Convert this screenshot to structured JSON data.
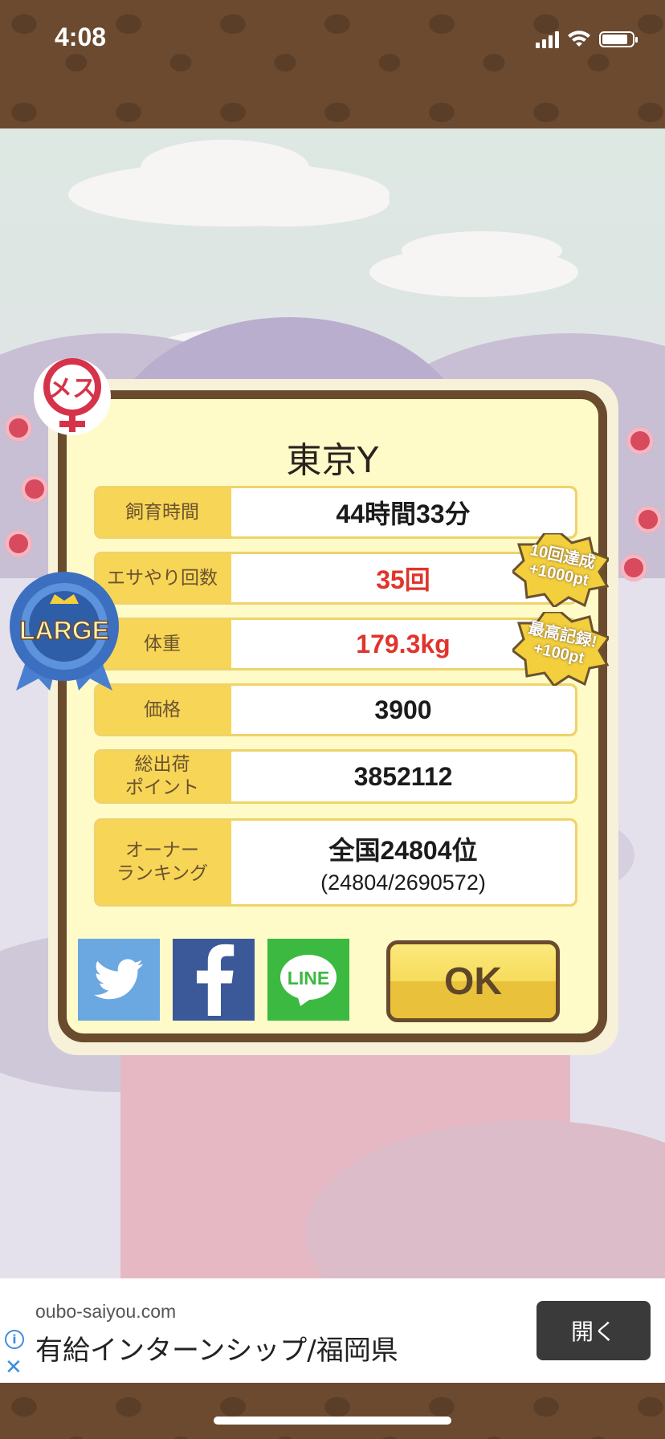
{
  "status": {
    "time": "4:08"
  },
  "dialog": {
    "title": "東京Y",
    "rows": [
      {
        "label": "飼育時間",
        "value": "44時間33分",
        "highlight": false
      },
      {
        "label": "エサやり回数",
        "value": "35回",
        "highlight": true
      },
      {
        "label": "体重",
        "value": "179.3kg",
        "highlight": true
      },
      {
        "label": "価格",
        "value": "3900",
        "highlight": false
      },
      {
        "label": "総出荷\nポイント",
        "value": "3852112",
        "highlight": false
      },
      {
        "label": "オーナー\nランキング",
        "value": "全国24804位",
        "sub": "(24804/2690572)",
        "highlight": false
      }
    ],
    "ok_label": "OK",
    "share": {
      "twitter_icon": "twitter-bird-icon",
      "facebook_icon": "facebook-f-icon",
      "line_label": "LINE"
    }
  },
  "badges": {
    "gender_label": "メス",
    "size_label": "LARGE",
    "bonus_1": "10回達成\n+1000pt",
    "bonus_2": "最高記録!\n+100pt"
  },
  "ad": {
    "domain": "oubo-saiyou.com",
    "title": "有給インターンシップ/福岡県",
    "open_label": "開く",
    "info_icon": "i"
  },
  "colors": {
    "accent_yellow": "#f7d557",
    "frame_brown": "#6a4b2e",
    "highlight_red": "#e0342c",
    "twitter_blue": "#6ba7e0",
    "facebook_blue": "#3b5998",
    "line_green": "#3cb941"
  }
}
